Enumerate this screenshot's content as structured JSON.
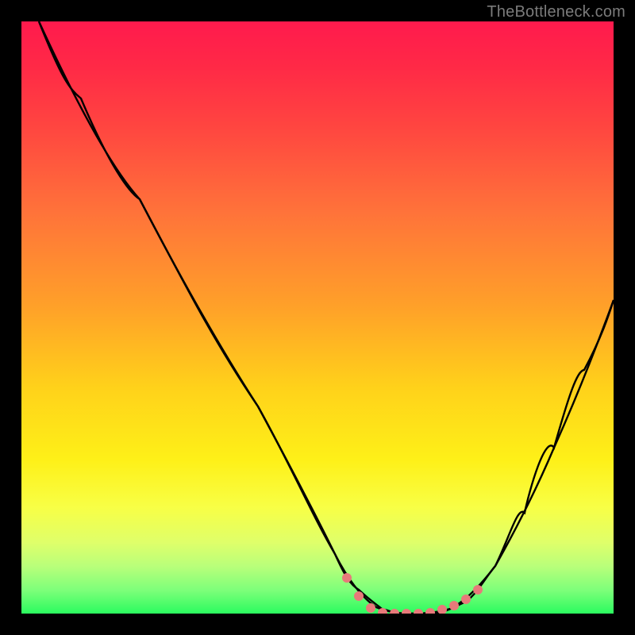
{
  "attribution": "TheBottleneck.com",
  "colors": {
    "frame": "#000000",
    "curve": "#000000",
    "markers": "#E77A7A",
    "gradient_top": "#ff1a4d",
    "gradient_bottom": "#2bfb5f"
  },
  "chart_data": {
    "type": "line",
    "title": "",
    "xlabel": "",
    "ylabel": "",
    "xlim": [
      0,
      100
    ],
    "ylim": [
      0,
      100
    ],
    "axes_visible": false,
    "grid": false,
    "series": [
      {
        "name": "bottleneck-curve",
        "x": [
          3,
          10,
          20,
          30,
          40,
          48,
          53,
          57,
          60,
          63,
          66,
          70,
          75,
          80,
          85,
          90,
          95,
          100
        ],
        "y": [
          100,
          87,
          70,
          52,
          35,
          20,
          10,
          4,
          1,
          0,
          0,
          0,
          2,
          8,
          17,
          28,
          40,
          53
        ]
      }
    ],
    "markers": {
      "name": "highlight-dots",
      "color": "#E77A7A",
      "x": [
        55,
        57,
        59,
        61,
        63,
        65,
        67,
        69,
        71,
        73,
        75,
        77
      ],
      "y": [
        6,
        3,
        1,
        0,
        0,
        0,
        0,
        0,
        1,
        1,
        2,
        4
      ]
    }
  }
}
